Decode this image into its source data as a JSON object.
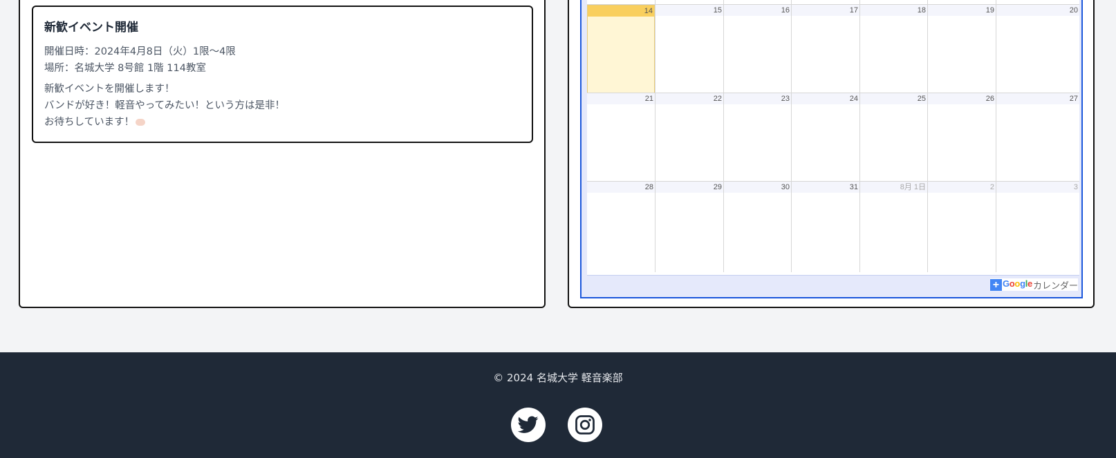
{
  "event": {
    "title": "新歓イベント開催",
    "date_line": "開催日時：2024年4月8日（火）1限〜4限",
    "place_line": "場所：名城大学 8号館 1階 114教室",
    "desc_lines": [
      "新歓イベントを開催します！",
      "バンドが好き！軽音やってみたい！という方は是非！",
      "お待ちしています！"
    ],
    "emoji_icon": "clapping-hands-icon"
  },
  "calendar": {
    "today_color": "#f9cf5e",
    "weeks": [
      {
        "days": [
          {
            "label": "14",
            "today": true
          },
          {
            "label": "15"
          },
          {
            "label": "16"
          },
          {
            "label": "17"
          },
          {
            "label": "18"
          },
          {
            "label": "19"
          },
          {
            "label": "20"
          }
        ]
      },
      {
        "days": [
          {
            "label": "21"
          },
          {
            "label": "22"
          },
          {
            "label": "23"
          },
          {
            "label": "24"
          },
          {
            "label": "25"
          },
          {
            "label": "26"
          },
          {
            "label": "27"
          }
        ]
      },
      {
        "days": [
          {
            "label": "28"
          },
          {
            "label": "29"
          },
          {
            "label": "30"
          },
          {
            "label": "31"
          },
          {
            "label": "8月 1日",
            "other": true
          },
          {
            "label": "2",
            "other": true
          },
          {
            "label": "3",
            "other": true
          }
        ]
      }
    ],
    "badge": {
      "plus": "+",
      "google": "Google",
      "word": "カレンダー"
    }
  },
  "footer": {
    "copyright": "© 2024 名城大学 軽音楽部",
    "twitter_icon": "twitter-icon",
    "instagram_icon": "instagram-icon"
  }
}
